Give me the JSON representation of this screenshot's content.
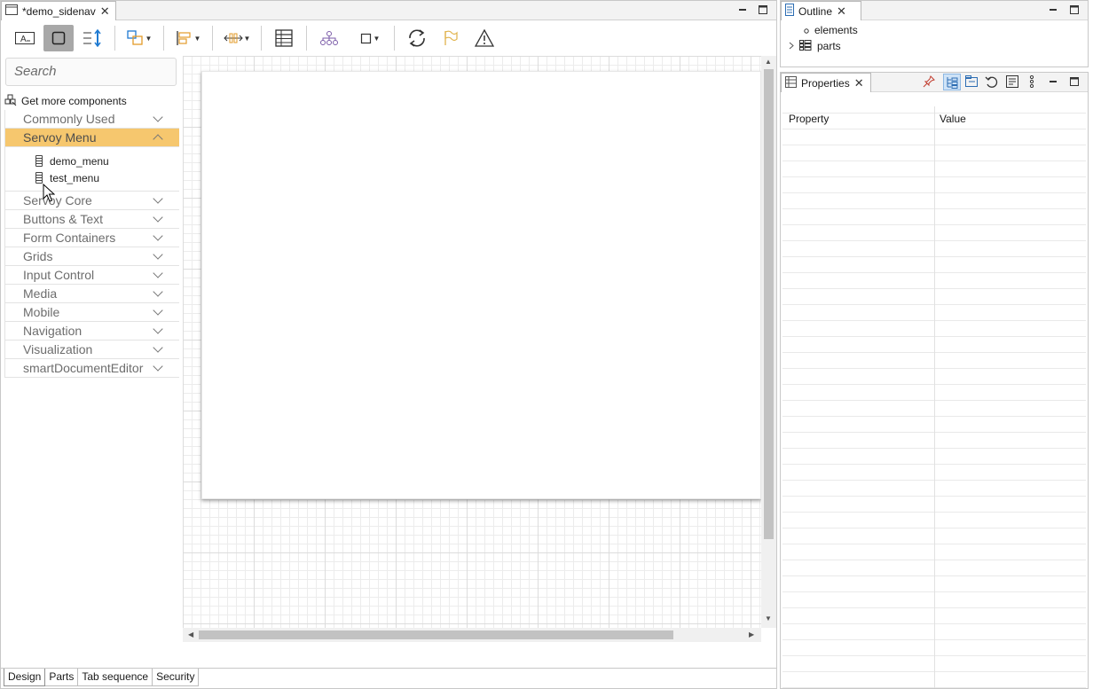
{
  "editor": {
    "tab_title": "*demo_sidenav",
    "toolbar_icons": [
      "text-label-icon",
      "select-icon",
      "resize-icon",
      "group-icon",
      "align-left-icon",
      "distribute-icon",
      "table-icon",
      "hierarchy-icon",
      "bounds-icon",
      "refresh-icon",
      "flag-icon",
      "warning-icon"
    ]
  },
  "palette": {
    "search_placeholder": "Search",
    "get_more": "Get more components",
    "categories": [
      {
        "label": "Commonly Used"
      },
      {
        "label": "Servoy Menu",
        "expanded": true,
        "items": [
          "demo_menu",
          "test_menu"
        ]
      },
      {
        "label": "Servoy Core"
      },
      {
        "label": "Buttons & Text"
      },
      {
        "label": "Form Containers"
      },
      {
        "label": "Grids"
      },
      {
        "label": "Input Control"
      },
      {
        "label": "Media"
      },
      {
        "label": "Mobile"
      },
      {
        "label": "Navigation"
      },
      {
        "label": "Visualization"
      },
      {
        "label": "smartDocumentEditor"
      }
    ]
  },
  "bottom_tabs": [
    "Design",
    "Parts",
    "Tab sequence",
    "Security"
  ],
  "outline": {
    "tab_title": "Outline",
    "items": [
      "elements",
      "parts"
    ]
  },
  "properties": {
    "tab_title": "Properties",
    "col_property": "Property",
    "col_value": "Value"
  },
  "colors": {
    "selected_category": "#f6c76e",
    "active_tool": "#a8a8a8"
  }
}
